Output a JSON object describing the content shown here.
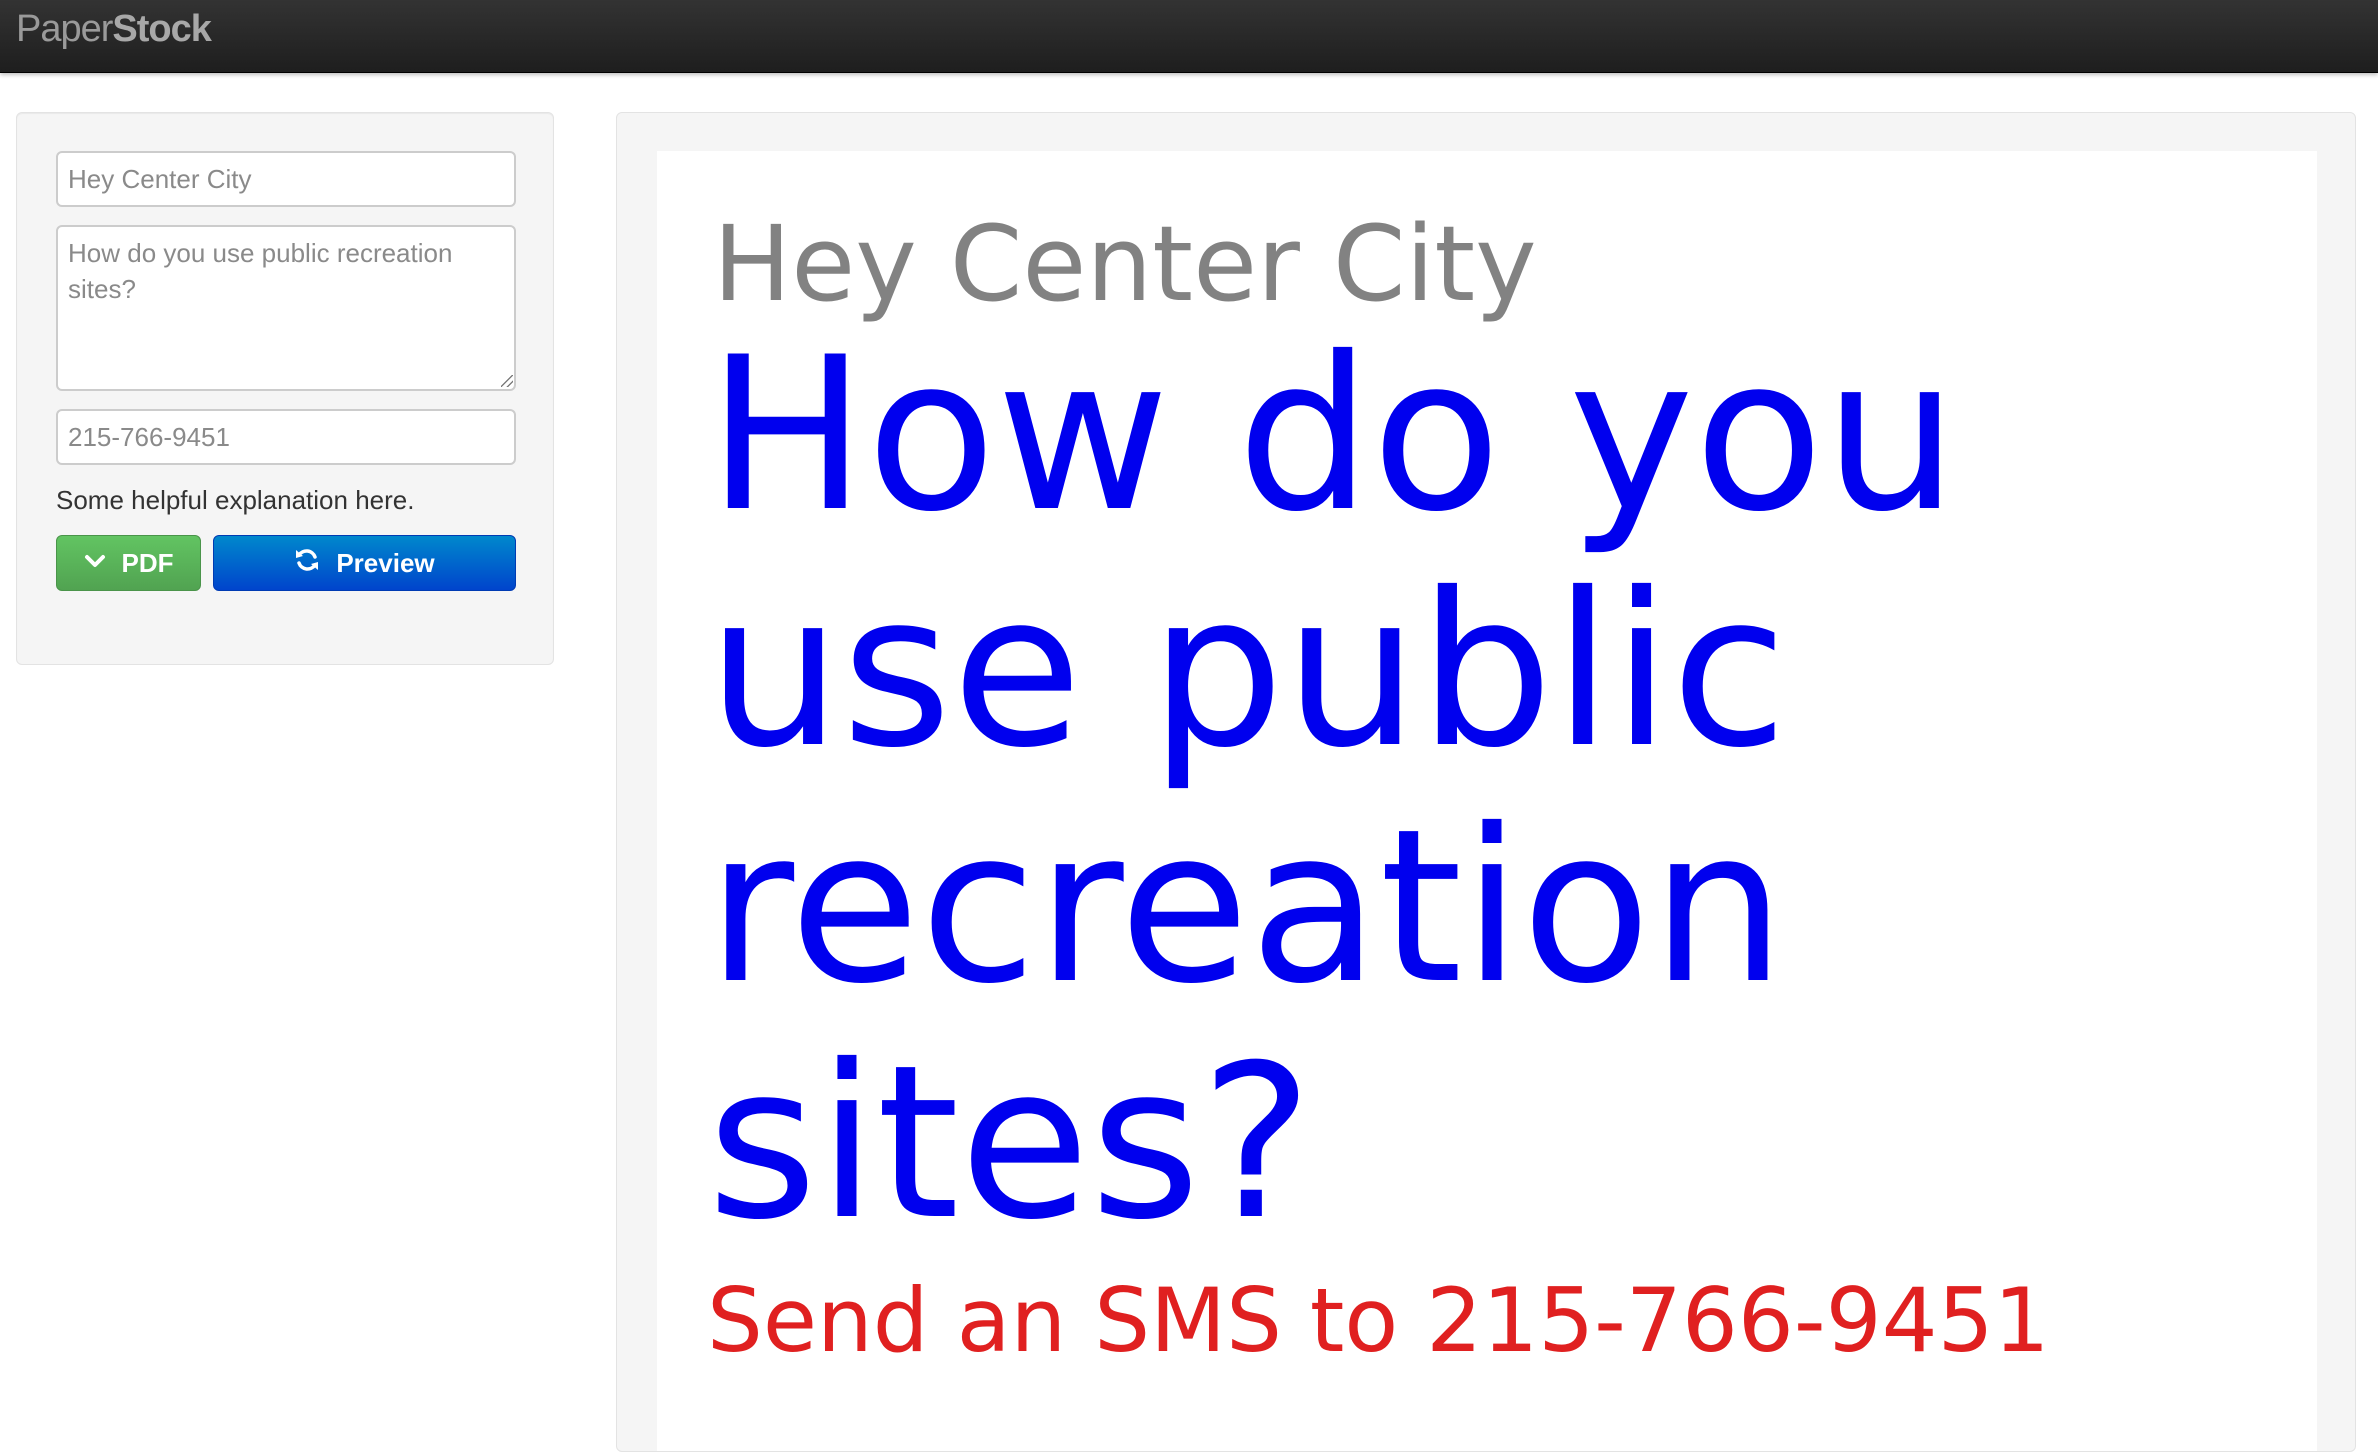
{
  "app": {
    "brand_light": "Paper",
    "brand_bold": "Stock"
  },
  "form": {
    "title_placeholder": "Hey Center City",
    "question_placeholder": "How do you use public recreation sites?",
    "phone_placeholder": "215-766-9451",
    "help_text": "Some helpful explanation here.",
    "pdf_label": "PDF",
    "pdf_icon": "chevron-down-icon",
    "preview_label": "Preview",
    "preview_icon": "refresh-icon"
  },
  "preview": {
    "title": "Hey Center City",
    "question": "How do you use public recreation sites?",
    "sms_line": "Send an SMS to 215-766-9451"
  },
  "colors": {
    "navbar": "#222222",
    "pdf_button": "#5bb75b",
    "preview_button": "#0066cc",
    "title_text": "#828282",
    "question_text": "#0000ee",
    "sms_text": "#e02020"
  }
}
